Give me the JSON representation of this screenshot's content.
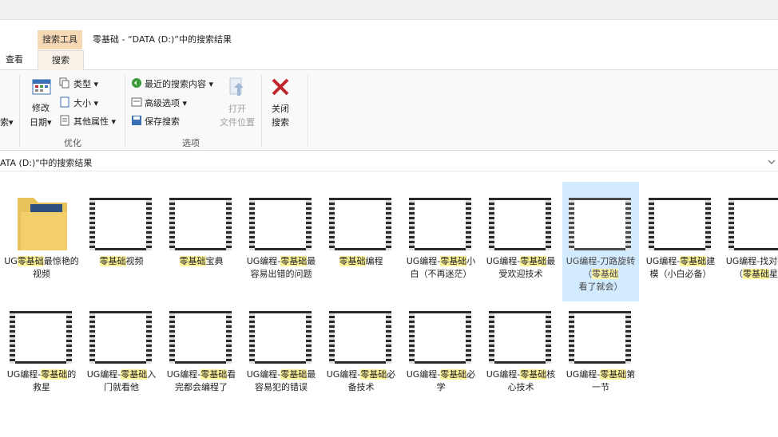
{
  "window": {
    "title": "零基础 - “DATA (D:)”中的搜索结果",
    "context_tab": "搜索工具"
  },
  "tabs": [
    {
      "label": "查看"
    },
    {
      "label": "搜索"
    }
  ],
  "ribbon": {
    "left_edge": "索▾",
    "modify_date": {
      "line1": "修改",
      "line2": "日期▾"
    },
    "type": "类型 ▾",
    "size": "大小 ▾",
    "other_props": "其他属性 ▾",
    "optimize_label": "优化",
    "recent": "最近的搜索内容 ▾",
    "advanced": "高级选项 ▾",
    "save_search": "保存搜索",
    "open_location": {
      "line1": "打开",
      "line2": "文件位置"
    },
    "options_label": "选项",
    "close_search": {
      "line1": "关闭",
      "line2": "搜索"
    }
  },
  "address": {
    "text": "ATA (D:)\"中的搜索结果",
    "chevron": "chevron-down-icon"
  },
  "colors": {
    "highlight": "#fff59a",
    "selection": "#cce8ff",
    "context_tab": "#f6d8b4",
    "close_red": "#c0262d"
  },
  "files": [
    {
      "pre": "UG",
      "hl": "零基础",
      "post": "最惊艳的视频",
      "kind": "folder"
    },
    {
      "pre": "",
      "hl": "零基础",
      "post": "视频",
      "kind": "video"
    },
    {
      "pre": "",
      "hl": "零基础",
      "post": "宝典",
      "kind": "video"
    },
    {
      "pre": "UG编程-",
      "hl": "零基础",
      "post": "最容易出错的问题",
      "kind": "video"
    },
    {
      "pre": "",
      "hl": "零基础",
      "post": "编程",
      "kind": "video"
    },
    {
      "pre": "UG编程-",
      "hl": "零基础",
      "post": "小白（不再迷茫）",
      "kind": "video"
    },
    {
      "pre": "UG编程-",
      "hl": "零基础",
      "post": "最受欢迎技术",
      "kind": "video"
    },
    {
      "pre": "UG编程-刀路旋转（",
      "hl": "零基础",
      "post": "看了就会）",
      "kind": "video",
      "selected": true
    },
    {
      "pre": "UG编程-",
      "hl": "零基础",
      "post": "建模（小白必备）",
      "kind": "video"
    },
    {
      "pre": "UG编程-找对破面（",
      "hl": "零基础",
      "post": "星）",
      "kind": "video"
    },
    {
      "pre": "UG编程-",
      "hl": "零基础",
      "post": "的救星",
      "kind": "video"
    },
    {
      "pre": "UG编程-",
      "hl": "零基础",
      "post": "入门就看他",
      "kind": "video"
    },
    {
      "pre": "UG编程-",
      "hl": "零基础",
      "post": "看完都会编程了",
      "kind": "video"
    },
    {
      "pre": "UG编程-",
      "hl": "零基础",
      "post": "最容易犯的错误",
      "kind": "video"
    },
    {
      "pre": "UG编程-",
      "hl": "零基础",
      "post": "必备技术",
      "kind": "video"
    },
    {
      "pre": "UG编程-",
      "hl": "零基础",
      "post": "必学",
      "kind": "video"
    },
    {
      "pre": "UG编程-",
      "hl": "零基础",
      "post": "核心技术",
      "kind": "video"
    },
    {
      "pre": "UG编程-",
      "hl": "零基础",
      "post": "第一节",
      "kind": "video"
    }
  ]
}
